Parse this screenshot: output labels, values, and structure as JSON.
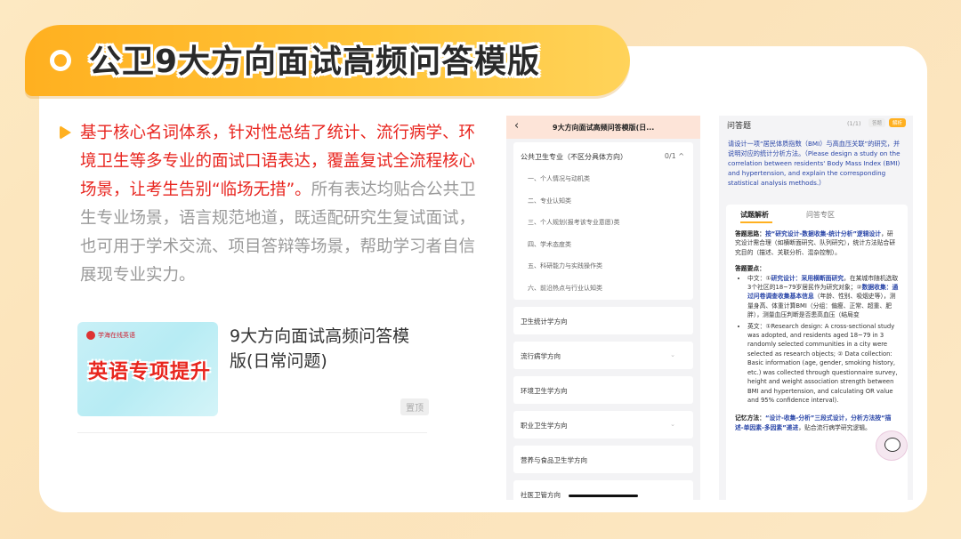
{
  "header": {
    "title": "公卫9大方向面试高频问答模版"
  },
  "intro": {
    "highlight": "基于核心名词体系，针对性总结了统计、流行病学、环境卫生等多专业的面试口语表达，覆盖复试全流程核心场景，让考生告别“临场无措”。",
    "rest": "所有表达均贴合公共卫生专业场景，语言规范地道，既适配研究生复试面试，也可用于学术交流、项目答辩等场景，帮助学习者自信展现专业实力。"
  },
  "file_card": {
    "thumb_logo": "学海在线英语",
    "thumb_text": "英语专项提升",
    "title": "9大方向面试高频问答模版(日常问题)",
    "badge": "置顶"
  },
  "phone1": {
    "title": "9大方向面试高频问答模版(日...",
    "section": {
      "label": "公共卫生专业（不区分具体方向）",
      "count": "0/1",
      "subitems": [
        "一、个人情况与动机类",
        "二、专业认知类",
        "三、个人规划(报考该专业意愿)类",
        "四、学术态度类",
        "五、科研能力与实践操作类",
        "六、前沿热点与行业认知类"
      ]
    },
    "items": [
      "卫生统计学方向",
      "流行病学方向",
      "环境卫生学方向",
      "职业卫生学方向",
      "营养与食品卫生学方向",
      "社医卫管方向"
    ]
  },
  "phone2": {
    "label": "问答题",
    "page": "(1/1)",
    "pill1": "答题",
    "pill2": "解析",
    "question": "请设计一项“居民体质指数（BMI）与高血压关联”的研究，并说明对应的统计分析方法。（Please design a study on the correlation between residents' Body Mass Index (BMI) and hypertension, and explain the corresponding statistical analysis methods.）",
    "tab_analysis": "试题解析",
    "tab_qa": "问答专区",
    "idea_label": "答题思路：",
    "idea_blue": "按“研究设计-数据收集-统计分析”逻辑设计",
    "idea_rest": "，研究设计需合理（如横断面研究、队列研究），统计方法贴合研究目的（描述、关联分析、混杂控制）。",
    "points_label": "答题要点：",
    "cn_prefix": "中文：①",
    "cn_blue1": "研究设计：采用横断面研究",
    "cn_text1": "，在某城市随机选取3个社区的18~79岁居民作为研究对象；②",
    "cn_blue2": "数据收集：通过问卷调查收集基本信息",
    "cn_text2": "（年龄、性别、吸烟史等），测量身高、体重计算BMI（分组：偏瘦、正常、超重、肥胖），测量血压判断是否患高血压（结局变",
    "en_text": "英文：①Research design: A cross-sectional study was adopted, and residents aged 18~79 in 3 randomly selected communities in a city were selected as research objects; ② Data collection: Basic information (age, gender, smoking history, etc.) was collected through questionnaire survey, height and weight association strength between BMI and hypertension, and calculating OR value and 95% confidence interval).",
    "memory_label": "记忆方法：",
    "memory_blue": "“设计-收集-分析”三段式设计，分析方法按“描述-单因素-多因素”递进",
    "memory_rest": "，贴合流行病学研究逻辑。"
  }
}
